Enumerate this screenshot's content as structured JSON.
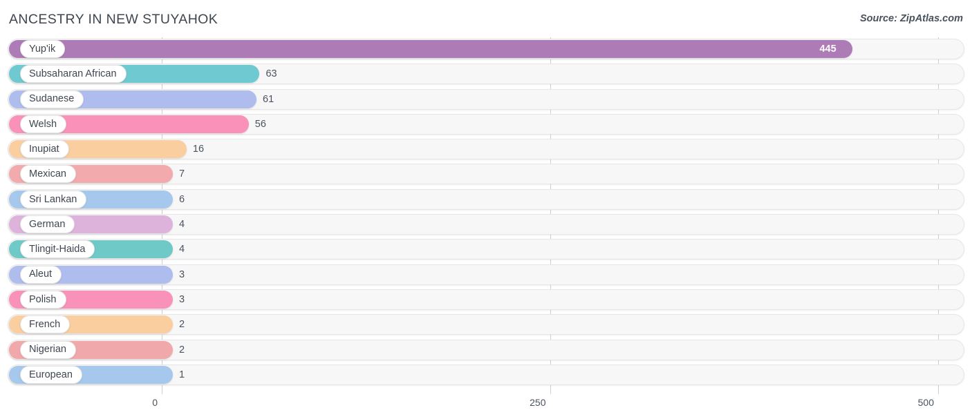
{
  "header": {
    "title": "ANCESTRY IN NEW STUYAHOK",
    "source": "Source: ZipAtlas.com"
  },
  "axis": {
    "ticks": [
      {
        "label": "0",
        "value": 0
      },
      {
        "label": "250",
        "value": 250
      },
      {
        "label": "500",
        "value": 500
      }
    ]
  },
  "chart_data": {
    "type": "bar",
    "orientation": "horizontal",
    "title": "ANCESTRY IN NEW STUYAHOK",
    "subtitle": "Source: ZipAtlas.com",
    "xlabel": "",
    "ylabel": "",
    "xlim": [
      0,
      500
    ],
    "grid": true,
    "legend": "none",
    "categories": [
      "Yup'ik",
      "Subsaharan African",
      "Sudanese",
      "Welsh",
      "Inupiat",
      "Mexican",
      "Sri Lankan",
      "German",
      "Tlingit-Haida",
      "Aleut",
      "Polish",
      "French",
      "Nigerian",
      "European"
    ],
    "values": [
      445,
      63,
      61,
      56,
      16,
      7,
      6,
      4,
      4,
      3,
      3,
      2,
      2,
      1
    ],
    "colors": [
      "#ad7bb5",
      "#6fc9d1",
      "#aebcee",
      "#f991b8",
      "#face9e",
      "#f2aaad",
      "#a5c8ec",
      "#ddb3dc",
      "#6fc9c6",
      "#aebcee",
      "#f991b8",
      "#face9e",
      "#f0a8ab",
      "#a5c8ec"
    ],
    "bars": [
      {
        "label": "Yup'ik",
        "value": 445,
        "value_text": "445",
        "color": "#ad7bb5",
        "label_inside": true
      },
      {
        "label": "Subsaharan African",
        "value": 63,
        "value_text": "63",
        "color": "#6fc9d1",
        "label_inside": false
      },
      {
        "label": "Sudanese",
        "value": 61,
        "value_text": "61",
        "color": "#aebcee",
        "label_inside": false
      },
      {
        "label": "Welsh",
        "value": 56,
        "value_text": "56",
        "color": "#f991b8",
        "label_inside": false
      },
      {
        "label": "Inupiat",
        "value": 16,
        "value_text": "16",
        "color": "#face9e",
        "label_inside": false
      },
      {
        "label": "Mexican",
        "value": 7,
        "value_text": "7",
        "color": "#f2aaad",
        "label_inside": false
      },
      {
        "label": "Sri Lankan",
        "value": 6,
        "value_text": "6",
        "color": "#a5c8ec",
        "label_inside": false
      },
      {
        "label": "German",
        "value": 4,
        "value_text": "4",
        "color": "#ddb3dc",
        "label_inside": false
      },
      {
        "label": "Tlingit-Haida",
        "value": 4,
        "value_text": "4",
        "color": "#6fc9c6",
        "label_inside": false
      },
      {
        "label": "Aleut",
        "value": 3,
        "value_text": "3",
        "color": "#aebcee",
        "label_inside": false
      },
      {
        "label": "Polish",
        "value": 3,
        "value_text": "3",
        "color": "#f991b8",
        "label_inside": false
      },
      {
        "label": "French",
        "value": 2,
        "value_text": "2",
        "color": "#face9e",
        "label_inside": false
      },
      {
        "label": "Nigerian",
        "value": 2,
        "value_text": "2",
        "color": "#f0a8ab",
        "label_inside": false
      },
      {
        "label": "European",
        "value": 1,
        "value_text": "1",
        "color": "#a5c8ec",
        "label_inside": false
      }
    ]
  }
}
